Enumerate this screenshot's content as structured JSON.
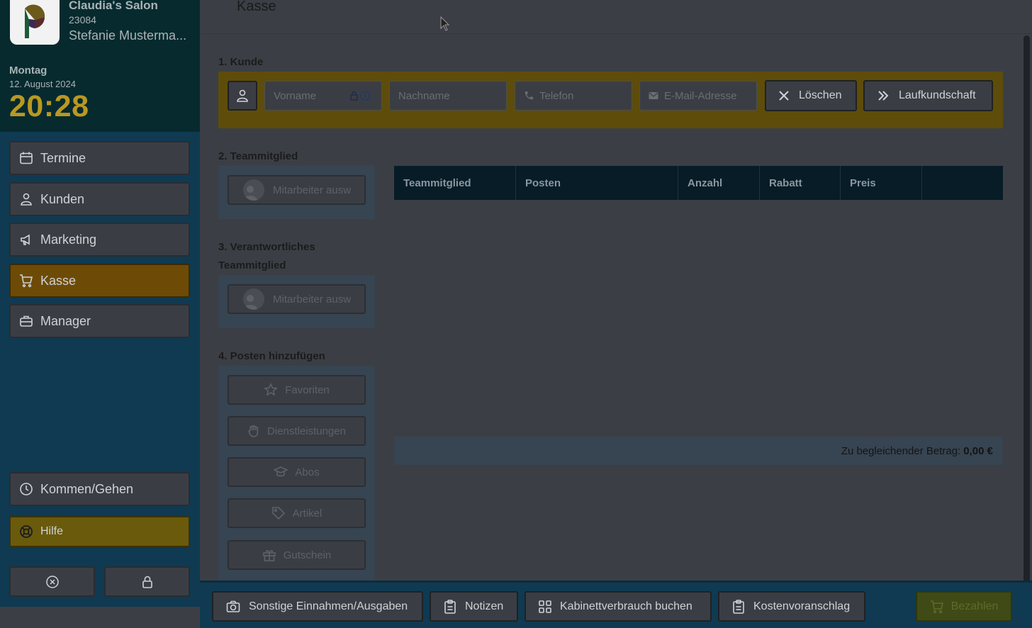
{
  "salon": {
    "name": "Claudia's Salon",
    "id": "23084",
    "user": "Stefanie Musterma..."
  },
  "clock": {
    "day": "Montag",
    "date": "12. August 2024",
    "time": "20:28"
  },
  "nav": {
    "items": [
      {
        "label": "Termine",
        "icon": "calendar-icon"
      },
      {
        "label": "Kunden",
        "icon": "users-icon"
      },
      {
        "label": "Marketing",
        "icon": "megaphone-icon"
      },
      {
        "label": "Kasse",
        "icon": "cart-icon",
        "active": true
      },
      {
        "label": "Manager",
        "icon": "briefcase-icon"
      }
    ],
    "clock_in": "Kommen/Gehen",
    "help": "Hilfe"
  },
  "page": {
    "title": "Kasse"
  },
  "section1": {
    "title": "1. Kunde",
    "firstname_placeholder": "Vorname",
    "lastname_placeholder": "Nachname",
    "phone_placeholder": "Telefon",
    "email_placeholder": "E-Mail-Adresse",
    "clear_label": "Löschen",
    "walkin_label": "Laufkundschaft"
  },
  "section2": {
    "title": "2. Teammitglied",
    "employee_placeholder": "Mitarbeiter ausw"
  },
  "section3": {
    "title_line1": "3. Verantwortliches",
    "title_line2": "Teammitglied",
    "employee_placeholder": "Mitarbeiter ausw"
  },
  "section4": {
    "title": "4. Posten hinzufügen",
    "buttons": [
      "Favoriten",
      "Dienstleistungen",
      "Abos",
      "Artikel",
      "Gutschein"
    ]
  },
  "table": {
    "columns": [
      "Teammitglied",
      "Posten",
      "Anzahl",
      "Rabatt",
      "Preis",
      ""
    ]
  },
  "total": {
    "label": "Zu begleichender Betrag:",
    "value": "0,00 €"
  },
  "footer": {
    "other": "Sonstige Einnahmen/Ausgaben",
    "notes": "Notizen",
    "cabinet": "Kabinettverbrauch buchen",
    "estimate": "Kostenvoranschlag",
    "pay": "Bezahlen"
  },
  "colors": {
    "accent": "#6d4b07",
    "sidebar": "#0f3a52",
    "header_dark": "#072a2e",
    "time": "#b99822"
  }
}
